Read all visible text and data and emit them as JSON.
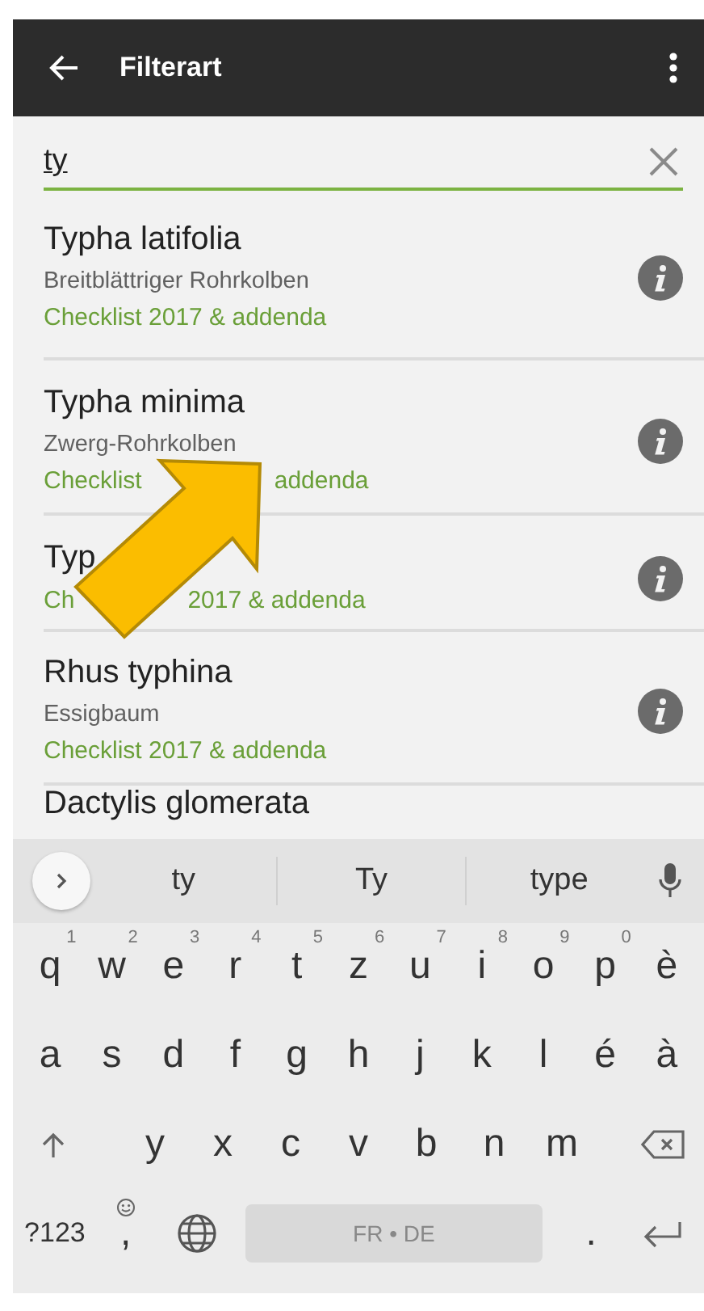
{
  "app_bar": {
    "title": "Filterart"
  },
  "search": {
    "value": "ty"
  },
  "results": [
    {
      "name": "Typha latifolia",
      "common": "Breitblättriger Rohrkolben",
      "source": [
        "Checklist 2017 & addenda"
      ]
    },
    {
      "name": "Typha minima",
      "common": "Zwerg-Rohrkolben",
      "source": [
        "Checklist",
        "addenda"
      ]
    },
    {
      "name": "Typ",
      "source": [
        "Ch",
        "2017 & addenda"
      ]
    },
    {
      "name": "Rhus typhina",
      "common": "Essigbaum",
      "source": [
        "Checklist 2017 & addenda"
      ]
    },
    {
      "name": "Dactylis glomerata"
    }
  ],
  "keyboard": {
    "suggestions": [
      "ty",
      "Ty",
      "type"
    ],
    "rows": [
      {
        "keys": [
          {
            "kind": "letter",
            "label": "q",
            "hint": "1"
          },
          {
            "kind": "letter",
            "label": "w",
            "hint": "2"
          },
          {
            "kind": "letter",
            "label": "e",
            "hint": "3"
          },
          {
            "kind": "letter",
            "label": "r",
            "hint": "4"
          },
          {
            "kind": "letter",
            "label": "t",
            "hint": "5"
          },
          {
            "kind": "letter",
            "label": "z",
            "hint": "6"
          },
          {
            "kind": "letter",
            "label": "u",
            "hint": "7"
          },
          {
            "kind": "letter",
            "label": "i",
            "hint": "8"
          },
          {
            "kind": "letter",
            "label": "o",
            "hint": "9"
          },
          {
            "kind": "letter",
            "label": "p",
            "hint": "0"
          },
          {
            "kind": "letter",
            "label": "è"
          }
        ]
      },
      {
        "keys": [
          {
            "kind": "letter",
            "label": "a"
          },
          {
            "kind": "letter",
            "label": "s"
          },
          {
            "kind": "letter",
            "label": "d"
          },
          {
            "kind": "letter",
            "label": "f"
          },
          {
            "kind": "letter",
            "label": "g"
          },
          {
            "kind": "letter",
            "label": "h"
          },
          {
            "kind": "letter",
            "label": "j"
          },
          {
            "kind": "letter",
            "label": "k"
          },
          {
            "kind": "letter",
            "label": "l"
          },
          {
            "kind": "letter",
            "label": "é"
          },
          {
            "kind": "letter",
            "label": "à"
          }
        ]
      },
      {
        "keys": [
          {
            "kind": "shift"
          },
          {
            "kind": "blank"
          },
          {
            "kind": "letter",
            "label": "y"
          },
          {
            "kind": "letter",
            "label": "x"
          },
          {
            "kind": "letter",
            "label": "c"
          },
          {
            "kind": "letter",
            "label": "v"
          },
          {
            "kind": "letter",
            "label": "b"
          },
          {
            "kind": "letter",
            "label": "n"
          },
          {
            "kind": "letter",
            "label": "m"
          },
          {
            "kind": "blank"
          },
          {
            "kind": "backspace"
          }
        ]
      },
      {
        "keys": [
          {
            "kind": "symbols",
            "label": "?123"
          },
          {
            "kind": "comma",
            "label": ","
          },
          {
            "kind": "globe"
          },
          {
            "kind": "space",
            "label": "FR • DE"
          },
          {
            "kind": "letter",
            "label": "."
          },
          {
            "kind": "enter"
          }
        ]
      }
    ]
  }
}
